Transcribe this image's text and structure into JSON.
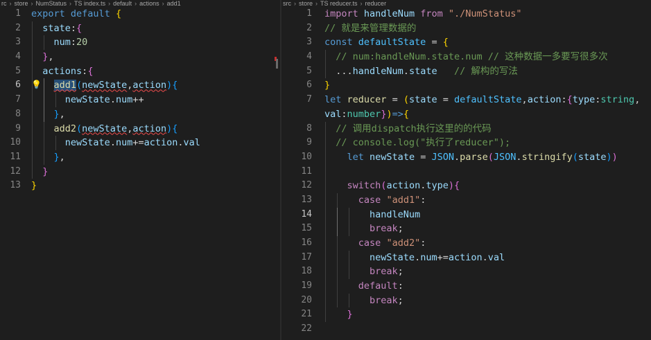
{
  "left": {
    "breadcrumb": [
      "rc",
      "store",
      "NumStatus",
      "TS index.ts",
      "default",
      "actions",
      "add1"
    ],
    "active_line": "6",
    "lines": [
      {
        "n": "1",
        "tokens": [
          {
            "c": "b",
            "t": "export"
          },
          {
            "t": " "
          },
          {
            "c": "b",
            "t": "default"
          },
          {
            "t": " "
          },
          {
            "c": "br1",
            "t": "{"
          }
        ]
      },
      {
        "n": "2",
        "tokens": [
          {
            "t": "  "
          },
          {
            "c": "v",
            "t": "state"
          },
          {
            "t": ":"
          },
          {
            "c": "br2",
            "t": "{"
          }
        ]
      },
      {
        "n": "3",
        "tokens": [
          {
            "t": "    "
          },
          {
            "c": "v",
            "t": "num"
          },
          {
            "t": ":"
          },
          {
            "c": "n",
            "t": "20"
          }
        ]
      },
      {
        "n": "4",
        "tokens": [
          {
            "t": "  "
          },
          {
            "c": "br2",
            "t": "}"
          },
          {
            "t": ","
          }
        ]
      },
      {
        "n": "5",
        "tokens": [
          {
            "t": "  "
          },
          {
            "c": "v",
            "t": "actions"
          },
          {
            "t": ":"
          },
          {
            "c": "br2",
            "t": "{"
          }
        ]
      },
      {
        "n": "6",
        "tokens": [
          {
            "t": "    "
          },
          {
            "c": "f sq selbg",
            "t": "add1"
          },
          {
            "c": "br3",
            "t": "("
          },
          {
            "c": "v sq",
            "t": "newState"
          },
          {
            "t": ","
          },
          {
            "c": "v sq",
            "t": "action"
          },
          {
            "c": "br3",
            "t": ")"
          },
          {
            "c": "br3",
            "t": "{"
          }
        ]
      },
      {
        "n": "7",
        "tokens": [
          {
            "t": "      "
          },
          {
            "c": "v",
            "t": "newState"
          },
          {
            "t": "."
          },
          {
            "c": "v",
            "t": "num"
          },
          {
            "t": "++"
          }
        ]
      },
      {
        "n": "8",
        "tokens": [
          {
            "t": "    "
          },
          {
            "c": "br3",
            "t": "}"
          },
          {
            "t": ","
          }
        ]
      },
      {
        "n": "9",
        "tokens": [
          {
            "t": "    "
          },
          {
            "c": "f",
            "t": "add2"
          },
          {
            "c": "br3",
            "t": "("
          },
          {
            "c": "v sq",
            "t": "newState"
          },
          {
            "t": ","
          },
          {
            "c": "v sq",
            "t": "action"
          },
          {
            "c": "br3",
            "t": ")"
          },
          {
            "c": "br3",
            "t": "{"
          }
        ]
      },
      {
        "n": "10",
        "tokens": [
          {
            "t": "      "
          },
          {
            "c": "v",
            "t": "newState"
          },
          {
            "t": "."
          },
          {
            "c": "v",
            "t": "num"
          },
          {
            "t": "+="
          },
          {
            "c": "v",
            "t": "action"
          },
          {
            "t": "."
          },
          {
            "c": "v",
            "t": "val"
          }
        ]
      },
      {
        "n": "11",
        "tokens": [
          {
            "t": "    "
          },
          {
            "c": "br3",
            "t": "}"
          },
          {
            "t": ","
          }
        ]
      },
      {
        "n": "12",
        "tokens": [
          {
            "t": "  "
          },
          {
            "c": "br2",
            "t": "}"
          }
        ]
      },
      {
        "n": "13",
        "tokens": [
          {
            "c": "br1",
            "t": "}"
          }
        ]
      }
    ]
  },
  "right": {
    "breadcrumb": [
      "src",
      "store",
      "TS reducer.ts",
      "reducer"
    ],
    "active_line": "14",
    "lines": [
      {
        "n": "1",
        "tokens": [
          {
            "c": "k",
            "t": "import"
          },
          {
            "t": " "
          },
          {
            "c": "v",
            "t": "handleNum"
          },
          {
            "t": " "
          },
          {
            "c": "k",
            "t": "from"
          },
          {
            "t": " "
          },
          {
            "c": "s",
            "t": "\"./NumStatus\""
          }
        ]
      },
      {
        "n": "2",
        "tokens": [
          {
            "c": "cm",
            "t": "// 就是来管理数据的"
          }
        ]
      },
      {
        "n": "3",
        "tokens": [
          {
            "c": "b",
            "t": "const"
          },
          {
            "t": " "
          },
          {
            "c": "c",
            "t": "defaultState"
          },
          {
            "t": " = "
          },
          {
            "c": "br1",
            "t": "{"
          }
        ]
      },
      {
        "n": "4",
        "tokens": [
          {
            "t": "  "
          },
          {
            "c": "cm",
            "t": "// num:handleNum.state.num // 这种数据一多要写很多次"
          }
        ]
      },
      {
        "n": "5",
        "tokens": [
          {
            "t": "  ..."
          },
          {
            "c": "v",
            "t": "handleNum"
          },
          {
            "t": "."
          },
          {
            "c": "v",
            "t": "state"
          },
          {
            "t": "   "
          },
          {
            "c": "cm",
            "t": "// 解构的写法"
          }
        ]
      },
      {
        "n": "6",
        "tokens": [
          {
            "c": "br1",
            "t": "}"
          }
        ]
      },
      {
        "n": "7",
        "tokens": [
          {
            "c": "b",
            "t": "let"
          },
          {
            "t": " "
          },
          {
            "c": "f",
            "t": "reducer"
          },
          {
            "t": " = "
          },
          {
            "c": "br1",
            "t": "("
          },
          {
            "c": "v",
            "t": "state"
          },
          {
            "t": " = "
          },
          {
            "c": "c",
            "t": "defaultState"
          },
          {
            "t": ","
          },
          {
            "c": "v",
            "t": "action"
          },
          {
            "t": ":"
          },
          {
            "c": "br2",
            "t": "{"
          },
          {
            "c": "v",
            "t": "type"
          },
          {
            "t": ":"
          },
          {
            "c": "t",
            "t": "string"
          },
          {
            "t": ","
          }
        ]
      },
      {
        "n": "",
        "tokens": [
          {
            "c": "v",
            "t": "val"
          },
          {
            "t": ":"
          },
          {
            "c": "t",
            "t": "number"
          },
          {
            "c": "br2",
            "t": "}"
          },
          {
            "c": "br1",
            "t": ")"
          },
          {
            "c": "b",
            "t": "=>"
          },
          {
            "c": "br1",
            "t": "{"
          }
        ]
      },
      {
        "n": "8",
        "tokens": [
          {
            "t": "  "
          },
          {
            "c": "cm",
            "t": "// 调用dispatch执行这里的的代码"
          }
        ]
      },
      {
        "n": "9",
        "tokens": [
          {
            "t": "  "
          },
          {
            "c": "cm",
            "t": "// console.log(\"执行了reducer\");"
          }
        ]
      },
      {
        "n": "10",
        "tokens": [
          {
            "t": "    "
          },
          {
            "c": "b",
            "t": "let"
          },
          {
            "t": " "
          },
          {
            "c": "v",
            "t": "newState"
          },
          {
            "t": " = "
          },
          {
            "c": "c",
            "t": "JSON"
          },
          {
            "t": "."
          },
          {
            "c": "f",
            "t": "parse"
          },
          {
            "c": "br2",
            "t": "("
          },
          {
            "c": "c",
            "t": "JSON"
          },
          {
            "t": "."
          },
          {
            "c": "f",
            "t": "stringify"
          },
          {
            "c": "br3",
            "t": "("
          },
          {
            "c": "v",
            "t": "state"
          },
          {
            "c": "br3",
            "t": ")"
          },
          {
            "c": "br2",
            "t": ")"
          }
        ]
      },
      {
        "n": "11",
        "tokens": []
      },
      {
        "n": "12",
        "tokens": [
          {
            "t": "    "
          },
          {
            "c": "k",
            "t": "switch"
          },
          {
            "c": "br2",
            "t": "("
          },
          {
            "c": "v",
            "t": "action"
          },
          {
            "t": "."
          },
          {
            "c": "v",
            "t": "type"
          },
          {
            "c": "br2",
            "t": ")"
          },
          {
            "c": "br2",
            "t": "{"
          }
        ]
      },
      {
        "n": "13",
        "tokens": [
          {
            "t": "      "
          },
          {
            "c": "k",
            "t": "case"
          },
          {
            "t": " "
          },
          {
            "c": "s",
            "t": "\"add1\""
          },
          {
            "t": ":"
          }
        ]
      },
      {
        "n": "14",
        "tokens": [
          {
            "t": "        "
          },
          {
            "c": "v",
            "t": "handleNum"
          }
        ]
      },
      {
        "n": "15",
        "tokens": [
          {
            "t": "        "
          },
          {
            "c": "k",
            "t": "break"
          },
          {
            "t": ";"
          }
        ]
      },
      {
        "n": "16",
        "tokens": [
          {
            "t": "      "
          },
          {
            "c": "k",
            "t": "case"
          },
          {
            "t": " "
          },
          {
            "c": "s",
            "t": "\"add2\""
          },
          {
            "t": ":"
          }
        ]
      },
      {
        "n": "17",
        "tokens": [
          {
            "t": "        "
          },
          {
            "c": "v",
            "t": "newState"
          },
          {
            "t": "."
          },
          {
            "c": "v",
            "t": "num"
          },
          {
            "t": "+="
          },
          {
            "c": "v",
            "t": "action"
          },
          {
            "t": "."
          },
          {
            "c": "v",
            "t": "val"
          }
        ]
      },
      {
        "n": "18",
        "tokens": [
          {
            "t": "        "
          },
          {
            "c": "k",
            "t": "break"
          },
          {
            "t": ";"
          }
        ]
      },
      {
        "n": "19",
        "tokens": [
          {
            "t": "      "
          },
          {
            "c": "k",
            "t": "default"
          },
          {
            "t": ":"
          }
        ]
      },
      {
        "n": "20",
        "tokens": [
          {
            "t": "        "
          },
          {
            "c": "k",
            "t": "break"
          },
          {
            "t": ";"
          }
        ]
      },
      {
        "n": "21",
        "tokens": [
          {
            "t": "    "
          },
          {
            "c": "br2",
            "t": "}"
          }
        ]
      },
      {
        "n": "22",
        "tokens": []
      }
    ]
  },
  "colors": {
    "background": "#1e1e1e",
    "line_number": "#858585",
    "error_marker": "#c72e2e"
  }
}
